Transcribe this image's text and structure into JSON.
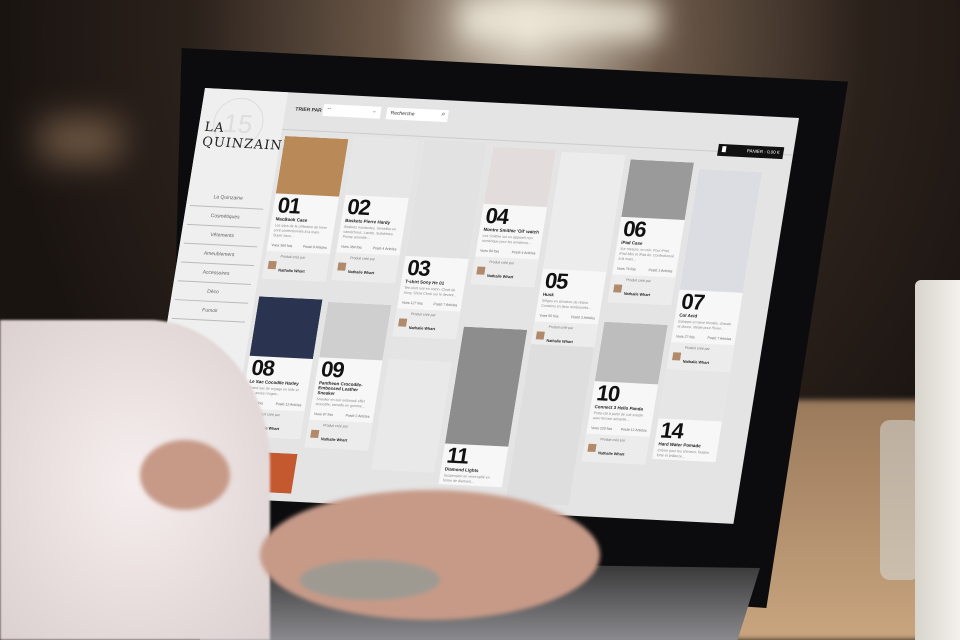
{
  "sidebar": {
    "logo": "LA QUINZAINE",
    "logo_badge": "15",
    "items": [
      "La Quinzaine",
      "Cosmétiques",
      "Vêtements",
      "Ameublement",
      "Accessoires",
      "Déco",
      "Fumoir"
    ]
  },
  "toolbar": {
    "sort_label": "TRIER PAR :",
    "sort_value": "--",
    "search_placeholder": "Recherche",
    "cart_label": "PANIER - 0,00 €"
  },
  "cards": [
    {
      "num": "01",
      "title": "MacBook Case",
      "desc": "Les sacs de la collection de hiver sont confectionnés à la main. Super sacs...",
      "views": "Vues 384 fois",
      "articles": "Posté 8 Articles",
      "by_label": "Produit créé par",
      "author": "Nathalie Whart"
    },
    {
      "num": "02",
      "title": "Baskets Pierre Hardy",
      "desc": "Baskets montantes. Semelles en caoutchouc. Lacets. Suédoises. Pointe arrondie...",
      "views": "Vues 384 fois",
      "articles": "Posté 4 Articles",
      "by_label": "Produit créé par",
      "author": "Nathalie Whart"
    },
    {
      "num": "03",
      "title": "T-shirt Sony Hc 01",
      "desc": "Tee-shirt noir en coton. Clock de Sony, Show Clock sur le devant...",
      "views": "Vues 127 fois",
      "articles": "Posté 7 Articles",
      "by_label": "Produit créé par",
      "author": "Nathalie Whart"
    },
    {
      "num": "04",
      "title": "Montre Smithie 'Oil' watch",
      "desc": "Les Smithie sur un appareil non numérique pour les amateurs...",
      "views": "Vues 84 fois",
      "articles": "Posté 4 Articles",
      "by_label": "Produit créé par",
      "author": "Nathalie Whart"
    },
    {
      "num": "05",
      "title": "Husk",
      "desc": "Sièges en structure de résine. Coussins en tissu rembourrés...",
      "views": "Vues 92 fois",
      "articles": "Posté 3 Articles",
      "by_label": "Produit créé par",
      "author": "Nathalie Whart"
    },
    {
      "num": "06",
      "title": "iPad Case",
      "desc": "Sur mesure, en cuir. Pour iPad, iPad Mini et iPad Air. Confectionné à la main...",
      "views": "Vues 76 fois",
      "articles": "Posté 3 Articles",
      "by_label": "Produit créé par",
      "author": "Nathalie Whart"
    },
    {
      "num": "07",
      "title": "Col Acid",
      "desc": "Écharpe en laine tricotée, chaude et douce, idéale pour l'hiver...",
      "views": "Vues 27 fois",
      "articles": "Posté 7 Articles",
      "by_label": "Produit créé par",
      "author": "Nathalie Whart"
    },
    {
      "num": "08",
      "title": "Le Sac Cocodile Harley",
      "desc": "Grand sac de voyage en toile et cuir, anses rouges...",
      "views": "Vues 7 fois",
      "articles": "Posté 12 Articles",
      "by_label": "Produit créé par",
      "author": "Nathalie Whart"
    },
    {
      "num": "09",
      "title": "Pantheon Crocodile-Embossed Leather Sneaker",
      "desc": "Sneaker en cuir embossé effet crocodile, semelle en gomme...",
      "views": "Vues 67 fois",
      "articles": "Posté 2 Articles",
      "by_label": "Produit créé par",
      "author": "Nathalie Whart"
    },
    {
      "num": "10",
      "title": "Connect 3 Hello Panda",
      "desc": "Porte-clé à partir de cuir souple avec fermoir aimanté...",
      "views": "Vues 229 fois",
      "articles": "Posté 12 Articles",
      "by_label": "Produit créé par",
      "author": "Nathalie Whart"
    },
    {
      "num": "11",
      "title": "Diamond Lights",
      "desc": "Suspension en verre taillé en forme de diamant...",
      "views": "",
      "articles": "",
      "by_label": "",
      "author": ""
    },
    {
      "num": "",
      "title": "",
      "desc": "",
      "views": "",
      "articles": "",
      "by_label": "",
      "author": ""
    },
    {
      "num": "",
      "title": "",
      "desc": "",
      "views": "",
      "articles": "",
      "by_label": "",
      "author": ""
    },
    {
      "num": "14",
      "title": "Hard Water Pomade",
      "desc": "Crème pour les cheveux, fixation forte et brillance...",
      "views": "",
      "articles": "",
      "by_label": "",
      "author": ""
    },
    {
      "num": "",
      "title": "",
      "desc": "",
      "views": "",
      "articles": "",
      "by_label": "",
      "author": ""
    }
  ]
}
